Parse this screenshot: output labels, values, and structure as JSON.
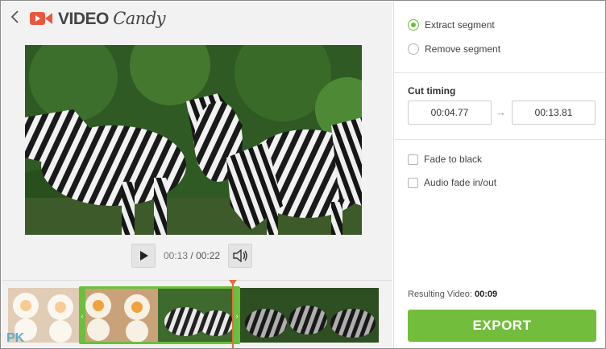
{
  "header": {
    "back_icon": "chevron-left-icon",
    "logo_icon": "video-camera-icon",
    "logo_bold": "VIDEO",
    "logo_script": "Candy"
  },
  "player": {
    "current_time": "00:13",
    "separator": "/",
    "total_time": "00:22",
    "play_icon": "play-icon",
    "volume_icon": "volume-icon"
  },
  "timeline": {
    "watermark": "PK"
  },
  "mode": {
    "extract_label": "Extract segment",
    "remove_label": "Remove segment",
    "selected": "extract"
  },
  "cut_timing": {
    "label": "Cut timing",
    "start": "00:04.77",
    "end": "00:13.81",
    "arrow": "→"
  },
  "effects": {
    "fade_black_label": "Fade to black",
    "fade_black_checked": false,
    "audio_fade_label": "Audio fade in/out",
    "audio_fade_checked": false
  },
  "result": {
    "label": "Resulting Video:",
    "value": "00:09"
  },
  "export_label": "EXPORT",
  "colors": {
    "accent_green": "#73bd3c",
    "playhead": "#e07040",
    "logo_red": "#e9573f"
  }
}
